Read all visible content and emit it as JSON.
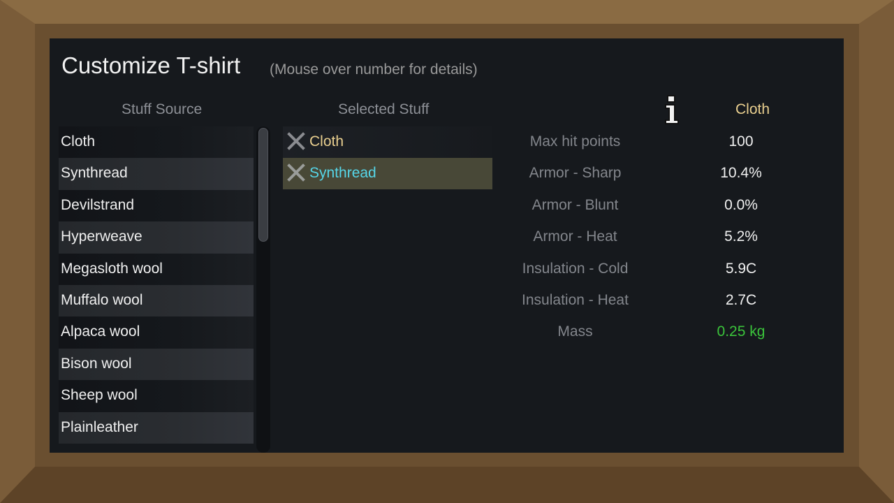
{
  "window": {
    "title": "Customize T-shirt",
    "subtitle": "(Mouse over number for details)"
  },
  "source": {
    "header": "Stuff Source",
    "items": [
      "Cloth",
      "Synthread",
      "Devilstrand",
      "Hyperweave",
      "Megasloth wool",
      "Muffalo wool",
      "Alpaca wool",
      "Bison wool",
      "Sheep wool",
      "Plainleather"
    ]
  },
  "selected": {
    "header": "Selected Stuff",
    "items": [
      {
        "label": "Cloth",
        "icon": "remove-x-icon"
      },
      {
        "label": "Synthread",
        "icon": "remove-x-icon"
      }
    ],
    "active_index": 1
  },
  "stats": {
    "info_icon": "info-icon",
    "column_header": "Cloth",
    "rows": [
      {
        "label": "Max hit points",
        "value": "100"
      },
      {
        "label": "Armor - Sharp",
        "value": "10.4%"
      },
      {
        "label": "Armor - Blunt",
        "value": "0.0%"
      },
      {
        "label": "Armor - Heat",
        "value": "5.2%"
      },
      {
        "label": "Insulation - Cold",
        "value": "5.9C"
      },
      {
        "label": "Insulation - Heat",
        "value": "2.7C"
      },
      {
        "label": "Mass",
        "value": "0.25 kg"
      }
    ]
  },
  "colors": {
    "frame": "#6f5333",
    "panel": "#16191d",
    "selected_text": "#e9cf8f",
    "active_text": "#56d6e8",
    "highlight": "#484837",
    "mass_value": "#3bc43b"
  }
}
